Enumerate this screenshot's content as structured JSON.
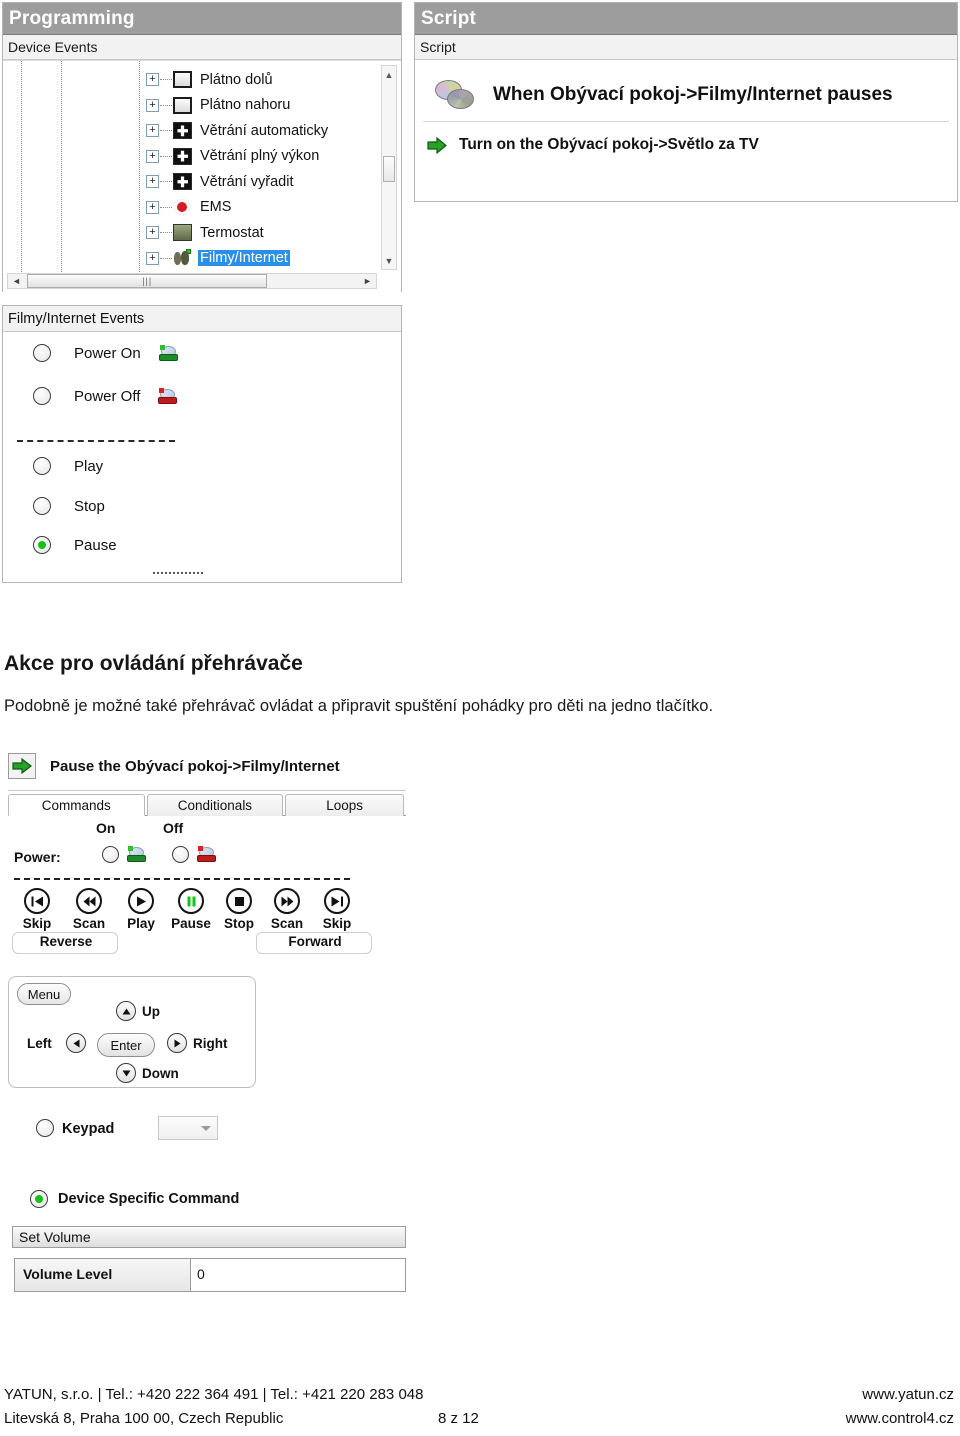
{
  "programming": {
    "title": "Programming",
    "subhead": "Device Events",
    "tree_items": [
      {
        "label": "Plátno dolů",
        "icon": "screen-icon",
        "selected": false
      },
      {
        "label": "Plátno nahoru",
        "icon": "screen-icon",
        "selected": false
      },
      {
        "label": "Větrání automaticky",
        "icon": "fan-icon",
        "selected": false
      },
      {
        "label": "Větrání plný výkon",
        "icon": "fan-icon",
        "selected": false
      },
      {
        "label": "Větrání vyřadit",
        "icon": "fan-icon",
        "selected": false
      },
      {
        "label": "EMS",
        "icon": "ems-icon",
        "selected": false
      },
      {
        "label": "Termostat",
        "icon": "thermostat-icon",
        "selected": false
      },
      {
        "label": "Filmy/Internet",
        "icon": "media-icon",
        "selected": true
      }
    ],
    "expander_glyph": "+",
    "scroll_up_glyph": "▲",
    "scroll_down_glyph": "▼",
    "scroll_left_glyph": "◄",
    "scroll_right_glyph": "►",
    "hthumb_grip": "|||"
  },
  "events": {
    "head": "Filmy/Internet Events",
    "items": [
      {
        "label": "Power On",
        "selected": false,
        "icon": "dvd-green-icon"
      },
      {
        "label": "Power Off",
        "selected": false,
        "icon": "dvd-red-icon"
      },
      {
        "label": "Play",
        "selected": false,
        "icon": ""
      },
      {
        "label": "Stop",
        "selected": false,
        "icon": ""
      },
      {
        "label": "Pause",
        "selected": true,
        "icon": ""
      }
    ]
  },
  "script": {
    "title": "Script",
    "subhead": "Script",
    "when_text": "When Obývací pokoj->Filmy/Internet pauses",
    "action_text": "Turn on the Obývací pokoj->Světlo za TV"
  },
  "document": {
    "heading": "Akce pro ovládání přehrávače",
    "paragraph": "Podobně je možné také přehrávač ovládat a připravit spuštění pohádky pro děti na jedno tlačítko."
  },
  "commands": {
    "header_text": "Pause the Obývací pokoj->Filmy/Internet",
    "tabs": [
      {
        "label": "Commands",
        "active": true
      },
      {
        "label": "Conditionals",
        "active": false
      },
      {
        "label": "Loops",
        "active": false
      }
    ],
    "on_label": "On",
    "off_label": "Off",
    "power_label": "Power:",
    "transport": [
      {
        "label": "Skip",
        "glyph": "skip-reverse-icon"
      },
      {
        "label": "Scan",
        "glyph": "scan-reverse-icon"
      },
      {
        "label": "Play",
        "glyph": "play-icon"
      },
      {
        "label": "Pause",
        "glyph": "pause-icon"
      },
      {
        "label": "Stop",
        "glyph": "stop-icon"
      },
      {
        "label": "Scan",
        "glyph": "scan-forward-icon"
      },
      {
        "label": "Skip",
        "glyph": "skip-forward-icon"
      }
    ],
    "group_reverse": "Reverse",
    "group_forward": "Forward",
    "nav": {
      "menu": "Menu",
      "up": "Up",
      "down": "Down",
      "left": "Left",
      "right": "Right",
      "enter": "Enter"
    },
    "keypad_label": "Keypad",
    "keypad_value": "",
    "device_specific_label": "Device Specific Command",
    "command_select_value": "Set Volume",
    "param_name": "Volume Level",
    "param_value": "0"
  },
  "footer": {
    "line1_left": "YATUN, s.r.o. | Tel.: +420 222 364 491 | Tel.: +421 220 283 048",
    "line2_left": "Litevská 8, Praha 100 00, Czech Republic",
    "page": "8 z 12",
    "line1_right": "www.yatun.cz",
    "line2_right": "www.control4.cz"
  },
  "colors": {
    "panel_header": "#9d9d9d",
    "selection": "#2a8fe8",
    "led_green": "#13c313",
    "arrow_green": "#2aa02a"
  }
}
